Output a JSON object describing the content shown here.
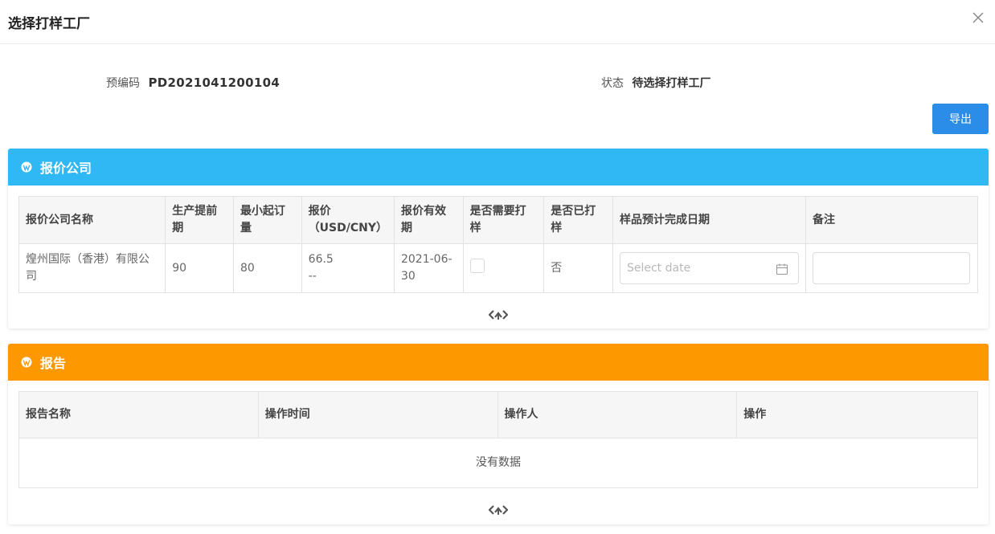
{
  "modal": {
    "title": "选择打样工厂"
  },
  "info": {
    "code_label": "预编码",
    "code_value": "PD2021041200104",
    "status_label": "状态",
    "status_value": "待选择打样工厂"
  },
  "toolbar": {
    "export_label": "导出"
  },
  "quote_panel": {
    "title": "报价公司",
    "color": "#2fb8f3",
    "columns": [
      "报价公司名称",
      "生产提前期",
      "最小起订量",
      "报价（USD/CNY）",
      "报价有效期",
      "是否需要打样",
      "是否已打样",
      "样品预计完成日期",
      "备注"
    ],
    "rows": [
      {
        "company": "煌州国际（香港）有限公司",
        "lead_time": "90",
        "moq": "80",
        "price_usd": "66.5",
        "price_cny": "--",
        "valid_until": "2021-06-30",
        "need_sample": false,
        "sampled": "否",
        "date_placeholder": "Select date",
        "note": ""
      }
    ]
  },
  "report_panel": {
    "title": "报告",
    "color": "#fe9800",
    "columns": [
      "报告名称",
      "操作时间",
      "操作人",
      "操作"
    ],
    "empty_text": "没有数据"
  },
  "icons": {
    "close": "close-icon",
    "panel": "wordpress-icon",
    "calendar": "calendar-icon",
    "collapse": "collapse-toggle-icon"
  }
}
